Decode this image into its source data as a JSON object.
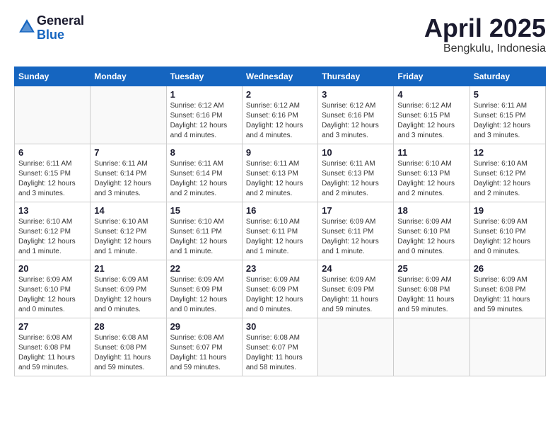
{
  "logo": {
    "general": "General",
    "blue": "Blue"
  },
  "title": {
    "month": "April 2025",
    "location": "Bengkulu, Indonesia"
  },
  "headers": [
    "Sunday",
    "Monday",
    "Tuesday",
    "Wednesday",
    "Thursday",
    "Friday",
    "Saturday"
  ],
  "weeks": [
    [
      {
        "day": "",
        "detail": ""
      },
      {
        "day": "",
        "detail": ""
      },
      {
        "day": "1",
        "detail": "Sunrise: 6:12 AM\nSunset: 6:16 PM\nDaylight: 12 hours\nand 4 minutes."
      },
      {
        "day": "2",
        "detail": "Sunrise: 6:12 AM\nSunset: 6:16 PM\nDaylight: 12 hours\nand 4 minutes."
      },
      {
        "day": "3",
        "detail": "Sunrise: 6:12 AM\nSunset: 6:16 PM\nDaylight: 12 hours\nand 3 minutes."
      },
      {
        "day": "4",
        "detail": "Sunrise: 6:12 AM\nSunset: 6:15 PM\nDaylight: 12 hours\nand 3 minutes."
      },
      {
        "day": "5",
        "detail": "Sunrise: 6:11 AM\nSunset: 6:15 PM\nDaylight: 12 hours\nand 3 minutes."
      }
    ],
    [
      {
        "day": "6",
        "detail": "Sunrise: 6:11 AM\nSunset: 6:15 PM\nDaylight: 12 hours\nand 3 minutes."
      },
      {
        "day": "7",
        "detail": "Sunrise: 6:11 AM\nSunset: 6:14 PM\nDaylight: 12 hours\nand 3 minutes."
      },
      {
        "day": "8",
        "detail": "Sunrise: 6:11 AM\nSunset: 6:14 PM\nDaylight: 12 hours\nand 2 minutes."
      },
      {
        "day": "9",
        "detail": "Sunrise: 6:11 AM\nSunset: 6:13 PM\nDaylight: 12 hours\nand 2 minutes."
      },
      {
        "day": "10",
        "detail": "Sunrise: 6:11 AM\nSunset: 6:13 PM\nDaylight: 12 hours\nand 2 minutes."
      },
      {
        "day": "11",
        "detail": "Sunrise: 6:10 AM\nSunset: 6:13 PM\nDaylight: 12 hours\nand 2 minutes."
      },
      {
        "day": "12",
        "detail": "Sunrise: 6:10 AM\nSunset: 6:12 PM\nDaylight: 12 hours\nand 2 minutes."
      }
    ],
    [
      {
        "day": "13",
        "detail": "Sunrise: 6:10 AM\nSunset: 6:12 PM\nDaylight: 12 hours\nand 1 minute."
      },
      {
        "day": "14",
        "detail": "Sunrise: 6:10 AM\nSunset: 6:12 PM\nDaylight: 12 hours\nand 1 minute."
      },
      {
        "day": "15",
        "detail": "Sunrise: 6:10 AM\nSunset: 6:11 PM\nDaylight: 12 hours\nand 1 minute."
      },
      {
        "day": "16",
        "detail": "Sunrise: 6:10 AM\nSunset: 6:11 PM\nDaylight: 12 hours\nand 1 minute."
      },
      {
        "day": "17",
        "detail": "Sunrise: 6:09 AM\nSunset: 6:11 PM\nDaylight: 12 hours\nand 1 minute."
      },
      {
        "day": "18",
        "detail": "Sunrise: 6:09 AM\nSunset: 6:10 PM\nDaylight: 12 hours\nand 0 minutes."
      },
      {
        "day": "19",
        "detail": "Sunrise: 6:09 AM\nSunset: 6:10 PM\nDaylight: 12 hours\nand 0 minutes."
      }
    ],
    [
      {
        "day": "20",
        "detail": "Sunrise: 6:09 AM\nSunset: 6:10 PM\nDaylight: 12 hours\nand 0 minutes."
      },
      {
        "day": "21",
        "detail": "Sunrise: 6:09 AM\nSunset: 6:09 PM\nDaylight: 12 hours\nand 0 minutes."
      },
      {
        "day": "22",
        "detail": "Sunrise: 6:09 AM\nSunset: 6:09 PM\nDaylight: 12 hours\nand 0 minutes."
      },
      {
        "day": "23",
        "detail": "Sunrise: 6:09 AM\nSunset: 6:09 PM\nDaylight: 12 hours\nand 0 minutes."
      },
      {
        "day": "24",
        "detail": "Sunrise: 6:09 AM\nSunset: 6:09 PM\nDaylight: 11 hours\nand 59 minutes."
      },
      {
        "day": "25",
        "detail": "Sunrise: 6:09 AM\nSunset: 6:08 PM\nDaylight: 11 hours\nand 59 minutes."
      },
      {
        "day": "26",
        "detail": "Sunrise: 6:09 AM\nSunset: 6:08 PM\nDaylight: 11 hours\nand 59 minutes."
      }
    ],
    [
      {
        "day": "27",
        "detail": "Sunrise: 6:08 AM\nSunset: 6:08 PM\nDaylight: 11 hours\nand 59 minutes."
      },
      {
        "day": "28",
        "detail": "Sunrise: 6:08 AM\nSunset: 6:08 PM\nDaylight: 11 hours\nand 59 minutes."
      },
      {
        "day": "29",
        "detail": "Sunrise: 6:08 AM\nSunset: 6:07 PM\nDaylight: 11 hours\nand 59 minutes."
      },
      {
        "day": "30",
        "detail": "Sunrise: 6:08 AM\nSunset: 6:07 PM\nDaylight: 11 hours\nand 58 minutes."
      },
      {
        "day": "",
        "detail": ""
      },
      {
        "day": "",
        "detail": ""
      },
      {
        "day": "",
        "detail": ""
      }
    ]
  ]
}
